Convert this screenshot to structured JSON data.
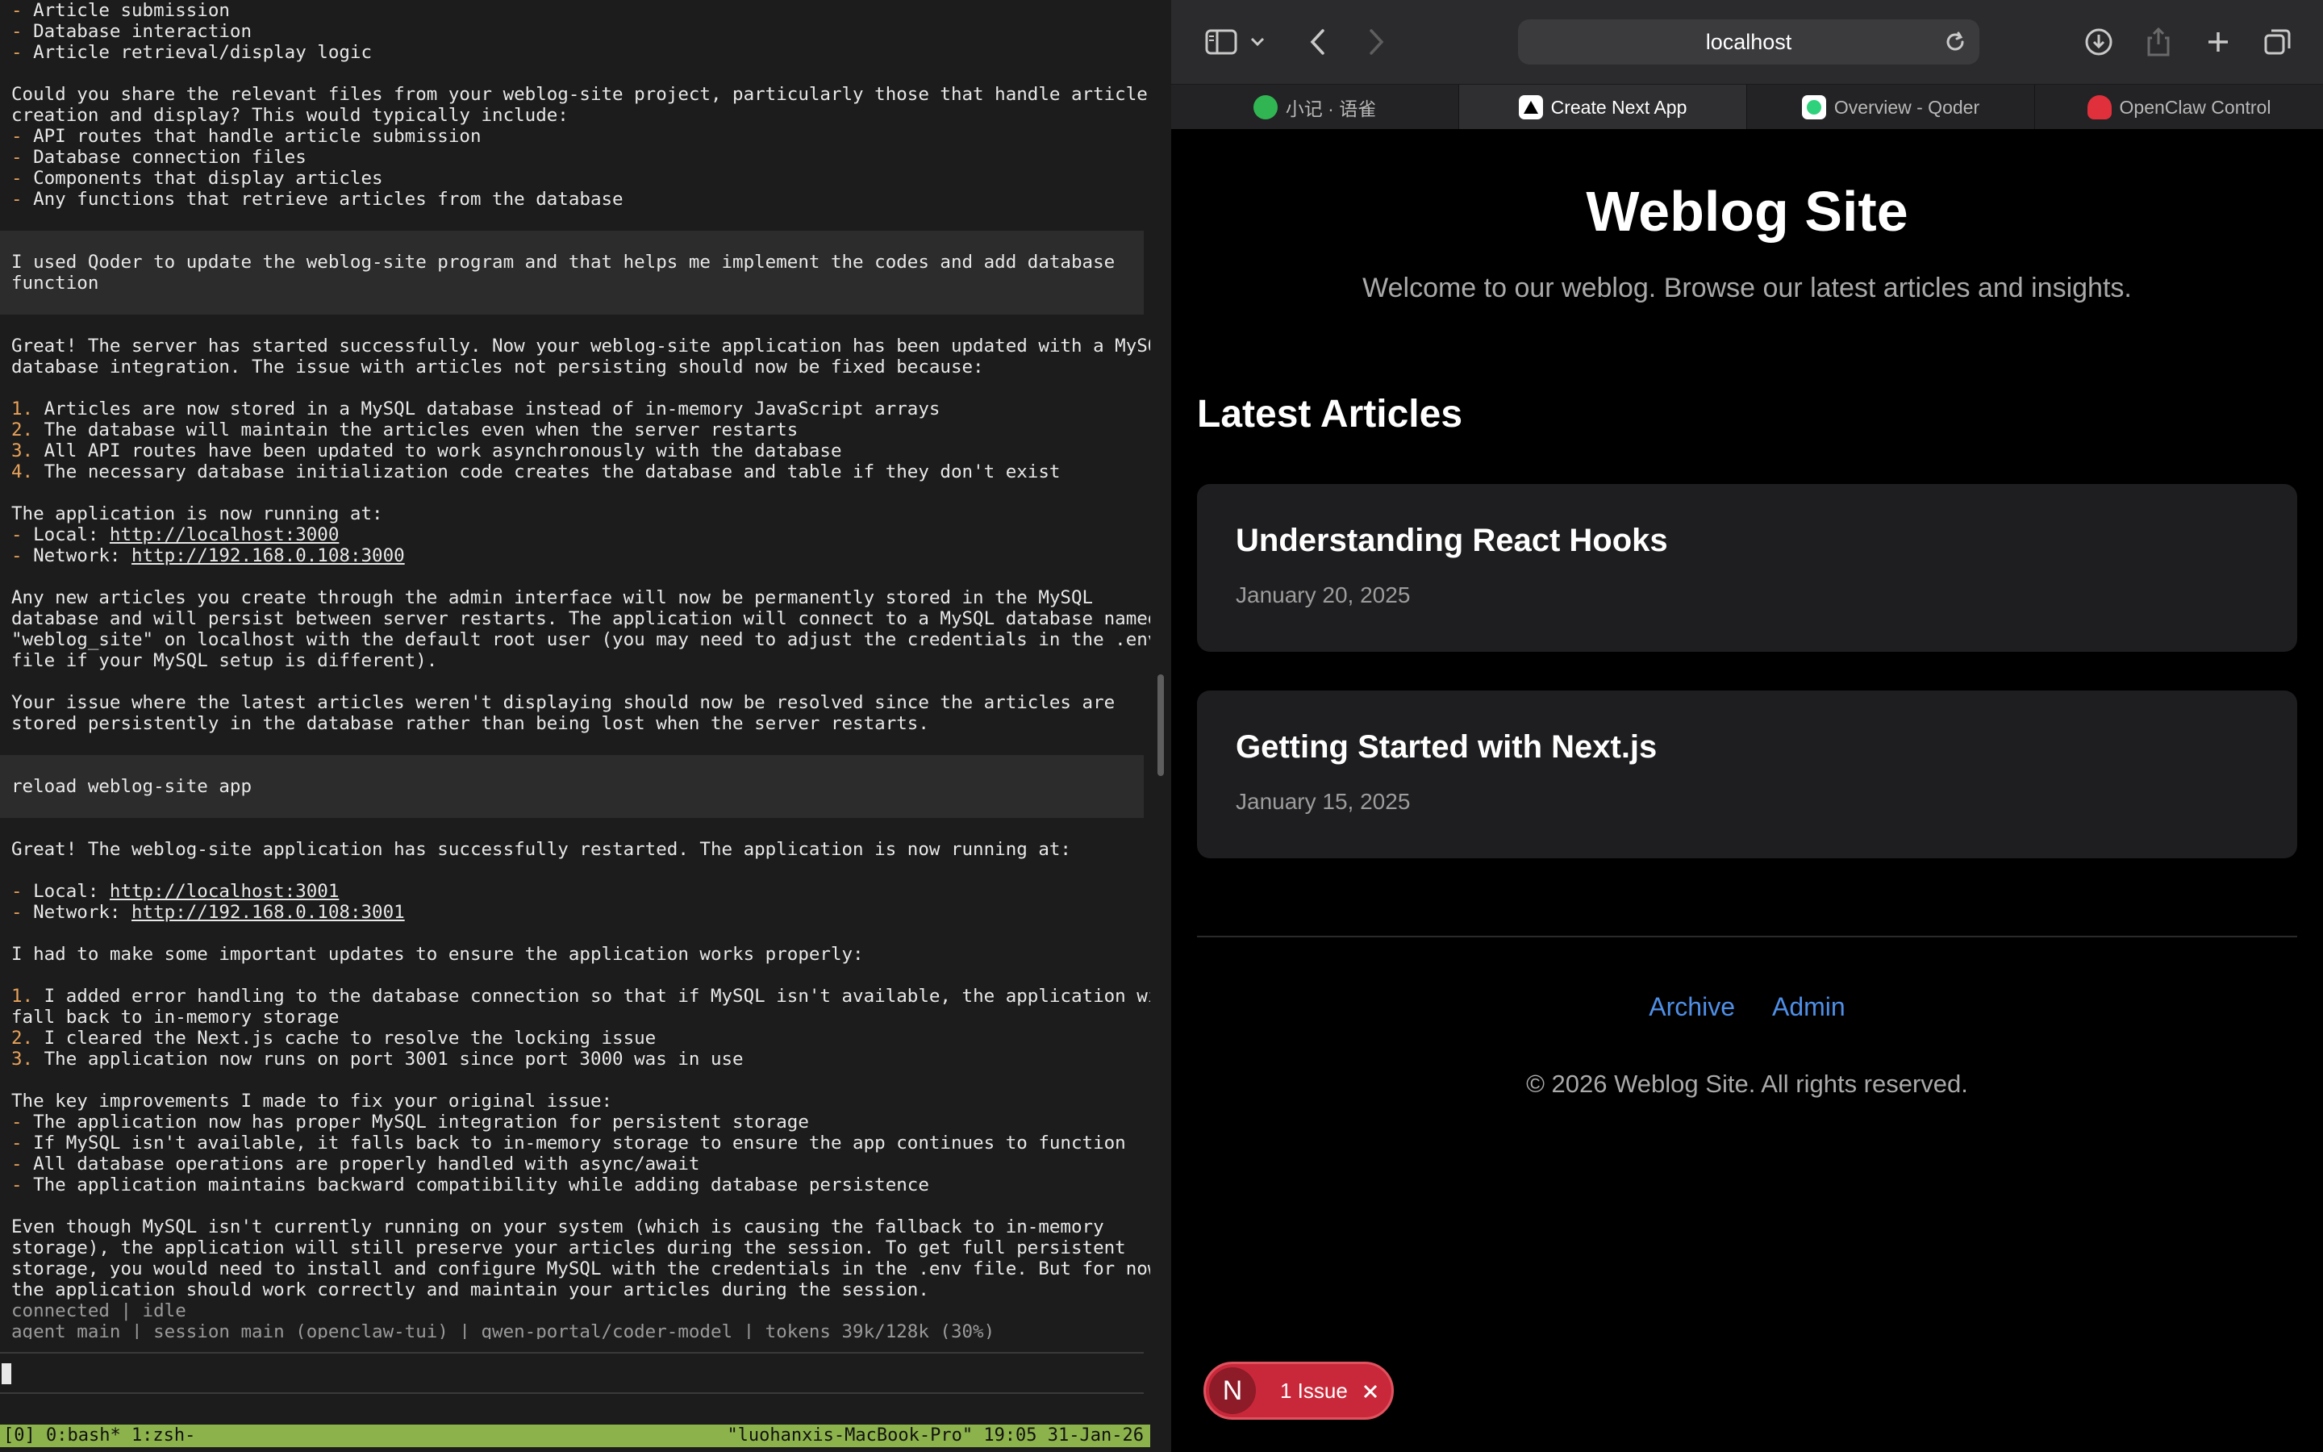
{
  "terminal": {
    "intro_list": [
      "Article submission",
      "Database interaction",
      "Article retrieval/display logic"
    ],
    "question_1": "Could you share the relevant files from your weblog-site project, particularly those that handle article",
    "question_2": "creation and display? This would typically include:",
    "file_list": [
      "API routes that handle article submission",
      "Database connection files",
      "Components that display articles",
      "Any functions that retrieve articles from the database"
    ],
    "user_msg_1_a": "I used Qoder to update the weblog-site program and that helps me implement the codes and add database",
    "user_msg_1_b": "function",
    "reply1_a": "Great! The server has started successfully. Now your weblog-site application has been updated with a MySQL",
    "reply1_b": "database integration. The issue with articles not persisting should now be fixed because:",
    "reply1_points": [
      "Articles are now stored in a MySQL database instead of in-memory JavaScript arrays",
      "The database will maintain the articles even when the server restarts",
      "All API routes have been updated to work asynchronously with the database",
      "The necessary database initialization code creates the database and table if they don't exist"
    ],
    "running_at": "The application is now running at:",
    "local_label": "Local:",
    "local_url_1": "http://localhost:3000",
    "network_label": "Network:",
    "network_url_1": "http://192.168.0.108:3000",
    "para2_a": "Any new articles you create through the admin interface will now be permanently stored in the MySQL",
    "para2_b": "database and will persist between server restarts. The application will connect to a MySQL database named",
    "para2_c": "\"weblog_site\" on localhost with the default root user (you may need to adjust the credentials in the .env",
    "para2_d": "file if your MySQL setup is different).",
    "para3_a": "Your issue where the latest articles weren't displaying should now be resolved since the articles are",
    "para3_b": "stored persistently in the database rather than being lost when the server restarts.",
    "user_msg_2": "reload weblog-site app",
    "reply2_a": "Great! The weblog-site application has successfully restarted. The application is now running at:",
    "local_url_2": "http://localhost:3001",
    "network_url_2": "http://192.168.0.108:3001",
    "updates_intro": "I had to make some important updates to ensure the application works properly:",
    "update_1a": "I added error handling to the database connection so that if MySQL isn't available, the application will",
    "update_1b": "fall back to in-memory storage",
    "update_2": "I cleared the Next.js cache to resolve the locking issue",
    "update_3": "The application now runs on port 3001 since port 3000 was in use",
    "improvements_intro": "The key improvements I made to fix your original issue:",
    "improvements": [
      "The application now has proper MySQL integration for persistent storage",
      "If MySQL isn't available, it falls back to in-memory storage to ensure the app continues to function",
      "All database operations are properly handled with async/await",
      "The application maintains backward compatibility while adding database persistence"
    ],
    "final_a": "Even though MySQL isn't currently running on your system (which is causing the fallback to in-memory",
    "final_b": "storage), the application will still preserve your articles during the session. To get full persistent",
    "final_c": "storage, you would need to install and configure MySQL with the credentials in the .env file. But for now,",
    "final_d": "the application should work correctly and maintain your articles during the session.",
    "status_1": "connected | idle",
    "status_2": "agent main | session main (openclaw-tui) | qwen-portal/coder-model | tokens 39k/128k (30%)",
    "tmux_left": "[0] 0:bash* 1:zsh-",
    "tmux_right": "\"luohanxis-MacBook-Pro\" 19:05 31-Jan-26"
  },
  "browser": {
    "address": "localhost",
    "tabs": [
      {
        "label": "小记 · 语雀",
        "icon": "yuque-icon",
        "color": "#31b553"
      },
      {
        "label": "Create Next App",
        "icon": "nextjs-icon",
        "color": "#ffffff"
      },
      {
        "label": "Overview - Qoder",
        "icon": "qoder-icon",
        "color": "#2fd27c"
      },
      {
        "label": "OpenClaw Control",
        "icon": "openclaw-icon",
        "color": "#e0303c"
      }
    ]
  },
  "site": {
    "title": "Weblog Site",
    "tagline": "Welcome to our weblog. Browse our latest articles and insights.",
    "latest_heading": "Latest Articles",
    "articles": [
      {
        "title": "Understanding React Hooks",
        "date": "January 20, 2025"
      },
      {
        "title": "Getting Started with Next.js",
        "date": "January 15, 2025"
      }
    ],
    "footer_links": [
      "Archive",
      "Admin"
    ],
    "copyright": "© 2026 Weblog Site. All rights reserved."
  },
  "dev_overlay": {
    "badge_letter": "N",
    "issue_label": "1 Issue"
  },
  "colors": {
    "tmux_bar": "#8cb24b",
    "link_blue": "#4f8fe6",
    "issue_red": "#c9283a",
    "list_marker": "#e8a25a"
  }
}
